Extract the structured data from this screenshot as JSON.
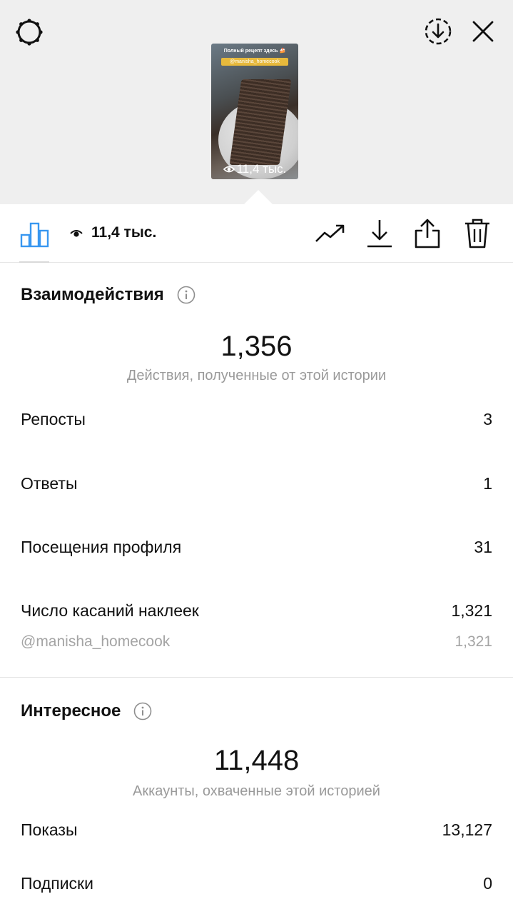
{
  "story_preview": {
    "caption_line1": "Полный рецепт здесь 🍰",
    "caption_mention": "@manisha_homecook",
    "views": "11,4 тыс."
  },
  "toolbar": {
    "views": "11,4 тыс.",
    "accent_color": "#3897f0"
  },
  "interactions": {
    "title": "Взаимодействия",
    "total": "1,356",
    "total_caption": "Действия, полученные от этой истории",
    "rows": [
      {
        "label": "Репосты",
        "value": "3"
      },
      {
        "label": "Ответы",
        "value": "1"
      },
      {
        "label": "Посещения профиля",
        "value": "31"
      },
      {
        "label": "Число касаний наклеек",
        "value": "1,321"
      }
    ],
    "sticker_detail": {
      "label": "@manisha_homecook",
      "value": "1,321"
    }
  },
  "discovery": {
    "title": "Интересное",
    "total": "11,448",
    "total_caption": "Аккаунты, охваченные этой историей",
    "rows": [
      {
        "label": "Показы",
        "value": "13,127"
      },
      {
        "label": "Подписки",
        "value": "0"
      }
    ]
  }
}
